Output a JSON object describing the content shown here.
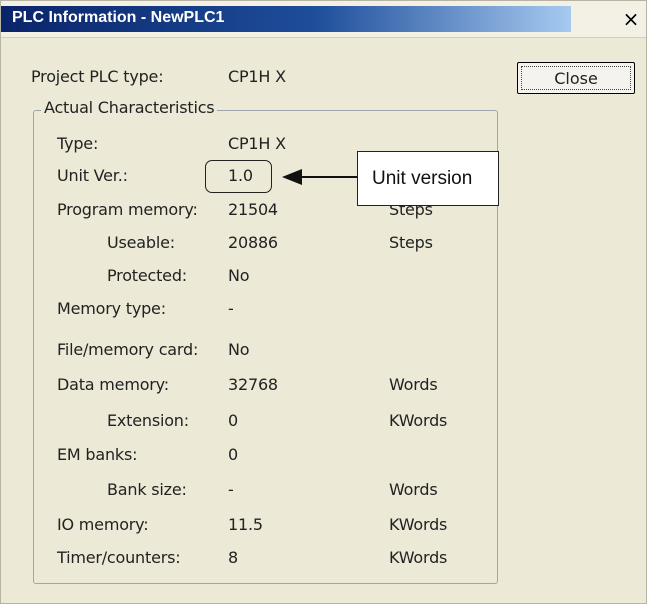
{
  "window": {
    "title": "PLC Information - NewPLC1",
    "close_glyph": "×"
  },
  "project": {
    "label": "Project PLC type:",
    "value": "CP1H X"
  },
  "close_button": {
    "label": "Close"
  },
  "group": {
    "title": "Actual Characteristics",
    "rows": [
      {
        "label": "Type:",
        "value": "CP1H X",
        "unit": ""
      },
      {
        "label": "Unit Ver.:",
        "value": "1.0",
        "unit": ""
      },
      {
        "label": "Program memory:",
        "value": "21504",
        "unit": "Steps"
      },
      {
        "label": "Useable:",
        "value": "20886",
        "unit": "Steps"
      },
      {
        "label": "Protected:",
        "value": "No",
        "unit": ""
      },
      {
        "label": "Memory type:",
        "value": "-",
        "unit": ""
      },
      {
        "label": "File/memory card:",
        "value": "No",
        "unit": ""
      },
      {
        "label": "Data memory:",
        "value": "32768",
        "unit": "Words"
      },
      {
        "label": "Extension:",
        "value": "0",
        "unit": "KWords"
      },
      {
        "label": "EM banks:",
        "value": "0",
        "unit": ""
      },
      {
        "label": "Bank size:",
        "value": "-",
        "unit": "Words"
      },
      {
        "label": "IO memory:",
        "value": "11.5",
        "unit": "KWords"
      },
      {
        "label": "Timer/counters:",
        "value": "8",
        "unit": "KWords"
      }
    ]
  },
  "annotation": {
    "callout_text": "Unit version"
  },
  "colors": {
    "titlebar_start": "#0a246a",
    "titlebar_end": "#a6caf0",
    "dialog_bg": "#ece9d6"
  }
}
